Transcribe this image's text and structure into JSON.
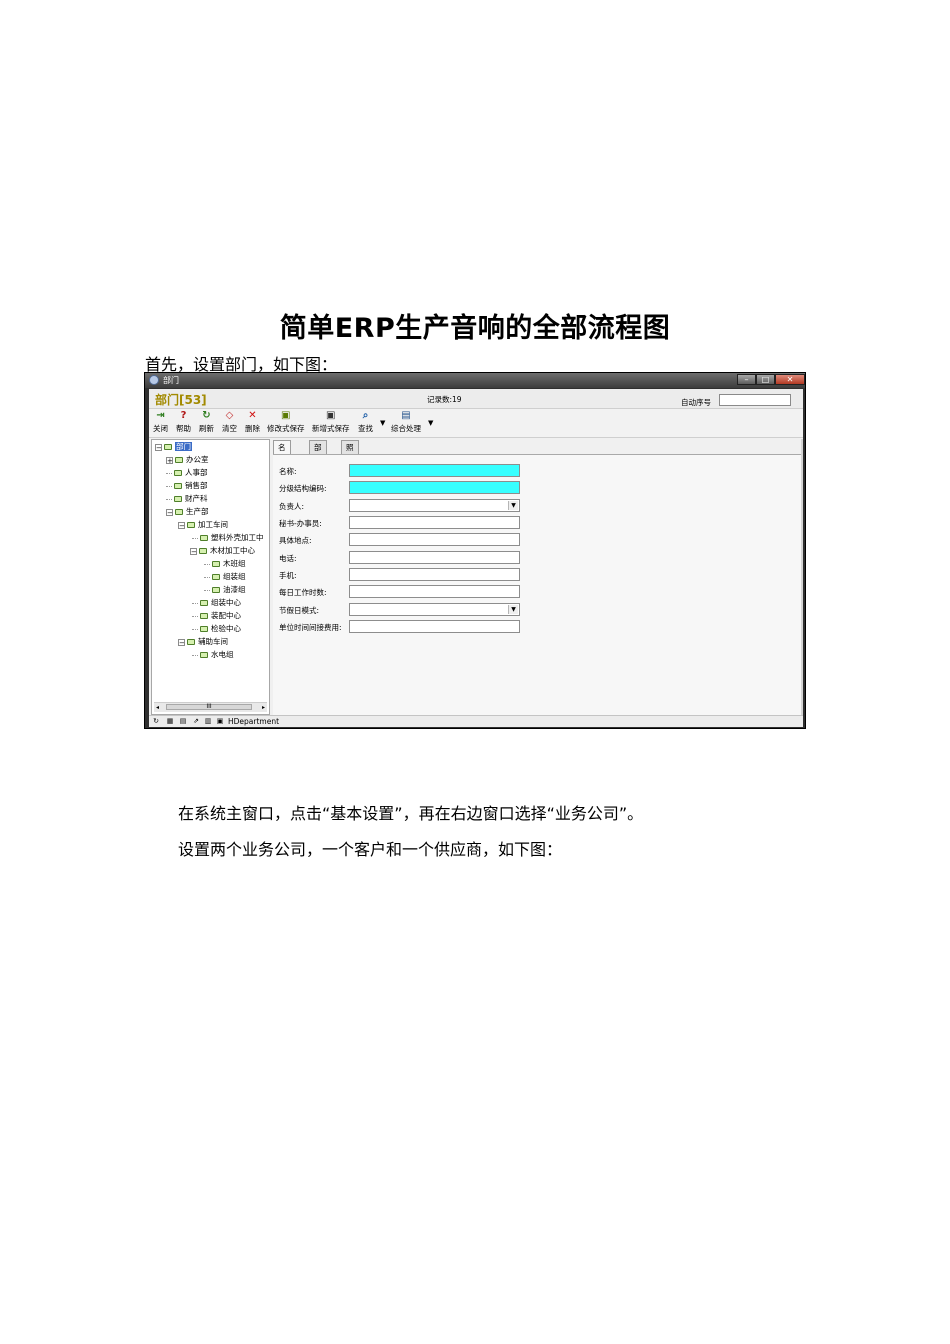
{
  "document": {
    "title": "简单ERP生产音响的全部流程图",
    "intro": "首先，设置部门，如下图：",
    "para_after_1": "在系统主窗口，点击“基本设置”，再在右边窗口选择“业务公司”。",
    "para_after_2": "设置两个业务公司，一个客户和一个供应商，如下图："
  },
  "window": {
    "title": "部门",
    "header_title": "部门[53]",
    "record_count": "记录数:19",
    "auto_seq_label": "自动序号",
    "toolbar": {
      "close": "关闭",
      "help": "帮助",
      "refresh": "刷新",
      "clear": "清空",
      "delete": "删除",
      "modify_save": "修改式保存",
      "add_save": "新增式保存",
      "find": "查找",
      "combined": "综合处理"
    },
    "tree": {
      "root": "部门",
      "office": "办公室",
      "hr": "人事部",
      "sales": "销售部",
      "finance": "财产科",
      "production": "生产部",
      "processing": "加工车间",
      "plastic": "塑料外壳加工中",
      "wood": "木材加工中心",
      "wood_team": "木班组",
      "assembly_team": "组装组",
      "paint_team": "油漆组",
      "assembly_center": "组装中心",
      "fitting_center": "装配中心",
      "inspection_center": "检验中心",
      "aux": "辅助车间",
      "utility": "水电组"
    },
    "tabs": [
      "名称",
      "部门类",
      "照片"
    ],
    "fields": {
      "name": "名称:",
      "code": "分级结构编码:",
      "manager": "负责人:",
      "secretary": "秘书-办事员:",
      "location": "具体地点:",
      "phone": "电话:",
      "mobile": "手机:",
      "hours": "每日工作时数:",
      "holiday": "节假日模式:",
      "indirect_cost": "单位时间间接费用:"
    },
    "status_text": "HDepartment",
    "colors": {
      "required_field": "#37ffff",
      "title_gold": "#a28a00",
      "selection": "#3b6cc6"
    }
  }
}
